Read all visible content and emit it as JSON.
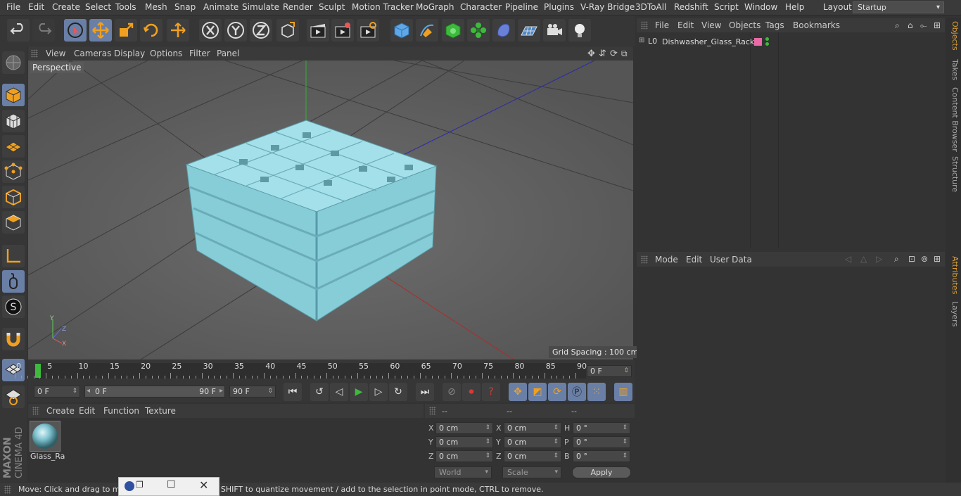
{
  "menubar": {
    "items": [
      "File",
      "Edit",
      "Create",
      "Select",
      "Tools",
      "Mesh",
      "Snap",
      "Animate",
      "Simulate",
      "Render",
      "Sculpt",
      "Motion Tracker",
      "MoGraph",
      "Character",
      "Pipeline",
      "Plugins",
      "V-Ray Bridge",
      "3DToAll",
      "Redshift",
      "Script",
      "Window",
      "Help"
    ],
    "layout_label": "Layout:",
    "layout_value": "Startup"
  },
  "viewport": {
    "menu": [
      "View",
      "Cameras",
      "Display",
      "Options",
      "Filter",
      "Panel"
    ],
    "camera_label": "Perspective",
    "grid_spacing": "Grid Spacing : 100 cm",
    "axis_x": "X",
    "axis_y": "Y",
    "axis_z": "Z"
  },
  "timeline": {
    "ticks": [
      "0",
      "5",
      "10",
      "15",
      "20",
      "25",
      "30",
      "35",
      "40",
      "45",
      "50",
      "55",
      "60",
      "65",
      "70",
      "75",
      "80",
      "85",
      "90"
    ],
    "current_frame": "0 F"
  },
  "transport": {
    "start_field": "0 F",
    "range_start": "0 F",
    "range_end": "90 F",
    "end_field": "90 F"
  },
  "material_manager": {
    "menu": [
      "Create",
      "Edit",
      "Function",
      "Texture"
    ],
    "materials": [
      {
        "name": "Glass_Ra"
      }
    ]
  },
  "coordinates": {
    "headers": [
      "--",
      "--",
      "--"
    ],
    "rows": [
      {
        "a_label": "X",
        "a_val": "0 cm",
        "b_label": "X",
        "b_val": "0 cm",
        "c_label": "H",
        "c_val": "0 °"
      },
      {
        "a_label": "Y",
        "a_val": "0 cm",
        "b_label": "Y",
        "b_val": "0 cm",
        "c_label": "P",
        "c_val": "0 °"
      },
      {
        "a_label": "Z",
        "a_val": "0 cm",
        "b_label": "Z",
        "b_val": "0 cm",
        "c_label": "B",
        "c_val": "0 °"
      }
    ],
    "space": "World",
    "mode": "Scale",
    "apply_label": "Apply"
  },
  "object_manager": {
    "menu": [
      "File",
      "Edit",
      "View",
      "Objects",
      "Tags",
      "Bookmarks"
    ],
    "objects": [
      {
        "name": "Dishwasher_Glass_Rack"
      }
    ]
  },
  "attribute_manager": {
    "menu": [
      "Mode",
      "Edit",
      "User Data"
    ]
  },
  "right_tabs": [
    "Objects",
    "Takes",
    "Content Browser",
    "Structure",
    "Attributes",
    "Layers"
  ],
  "brand": {
    "maxon": "MAXON",
    "product": "CINEMA 4D"
  },
  "status": {
    "text": "Move: Click and drag to move elements. Hold down SHIFT to quantize movement / add to the selection in point mode, CTRL to remove."
  },
  "colors": {
    "accent_blue": "#6a7fa6",
    "rack_color": "#8fd3de",
    "tab_active": "#e0a030",
    "play_green": "#3dba3d",
    "record_red": "#d43a3a"
  }
}
